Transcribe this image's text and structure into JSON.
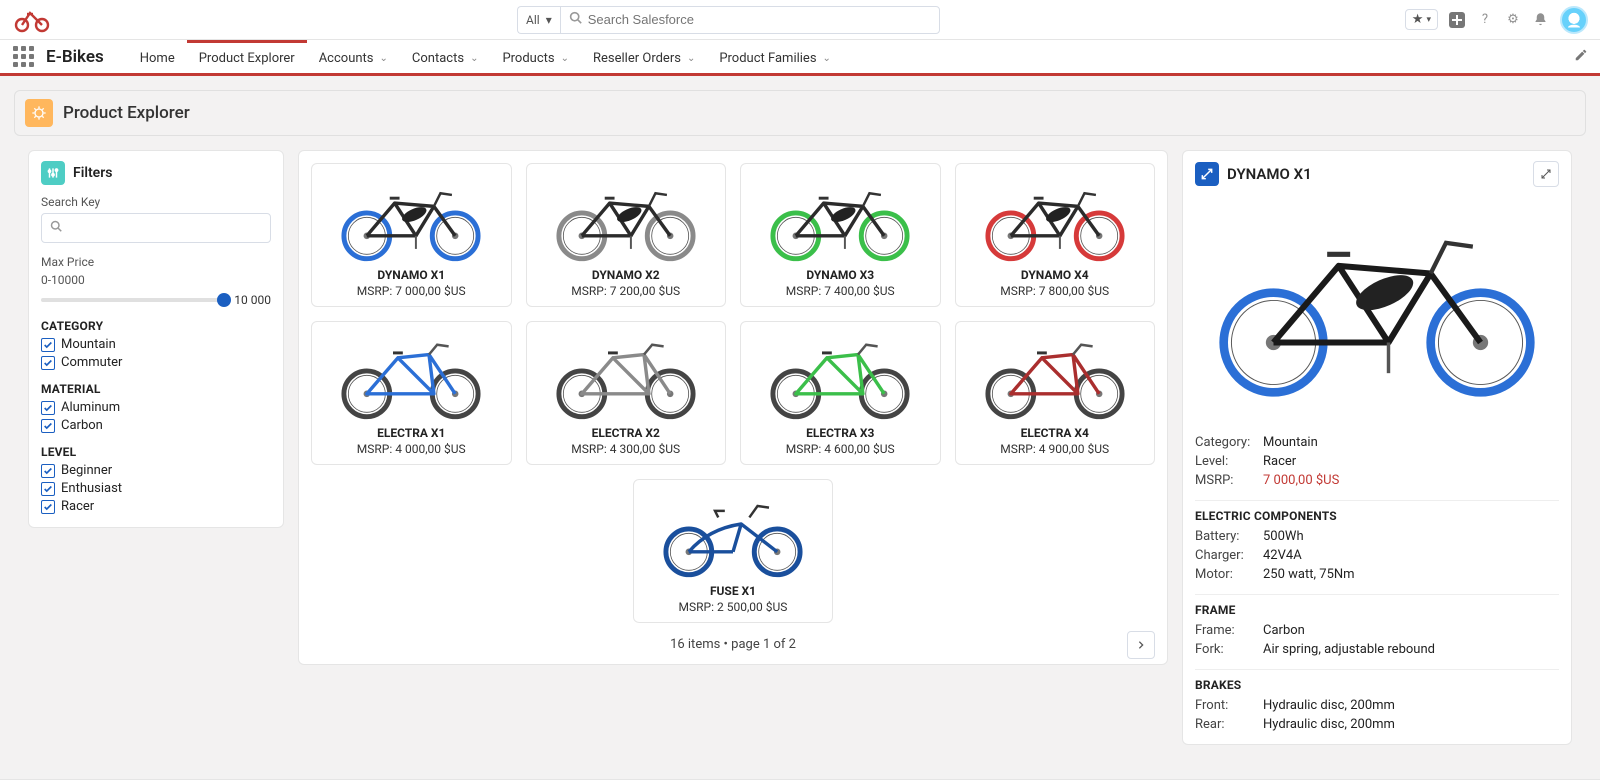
{
  "header": {
    "search_scope": "All",
    "search_placeholder": "Search Salesforce"
  },
  "nav": {
    "app_name": "E-Bikes",
    "items": [
      {
        "label": "Home",
        "dropdown": false,
        "active": false
      },
      {
        "label": "Product Explorer",
        "dropdown": false,
        "active": true
      },
      {
        "label": "Accounts",
        "dropdown": true,
        "active": false
      },
      {
        "label": "Contacts",
        "dropdown": true,
        "active": false
      },
      {
        "label": "Products",
        "dropdown": true,
        "active": false
      },
      {
        "label": "Reseller Orders",
        "dropdown": true,
        "active": false
      },
      {
        "label": "Product Families",
        "dropdown": true,
        "active": false
      }
    ]
  },
  "page_header": {
    "title": "Product Explorer"
  },
  "filters": {
    "title": "Filters",
    "search_key_label": "Search Key",
    "max_price_label": "Max Price",
    "max_price_range": "0-10000",
    "max_price_value": "10 000",
    "groups": [
      {
        "title": "CATEGORY",
        "options": [
          {
            "label": "Mountain",
            "checked": true
          },
          {
            "label": "Commuter",
            "checked": true
          }
        ]
      },
      {
        "title": "MATERIAL",
        "options": [
          {
            "label": "Aluminum",
            "checked": true
          },
          {
            "label": "Carbon",
            "checked": true
          }
        ]
      },
      {
        "title": "LEVEL",
        "options": [
          {
            "label": "Beginner",
            "checked": true
          },
          {
            "label": "Enthusiast",
            "checked": true
          },
          {
            "label": "Racer",
            "checked": true
          }
        ]
      }
    ]
  },
  "products": [
    {
      "name": "DYNAMO X1",
      "msrp": "MSRP: 7 000,00 $US",
      "style": "urban",
      "wheel": "#2b6fd6",
      "frame": "#2b2b2b"
    },
    {
      "name": "DYNAMO X2",
      "msrp": "MSRP: 7 200,00 $US",
      "style": "urban",
      "wheel": "#8a8a8a",
      "frame": "#2b2b2b"
    },
    {
      "name": "DYNAMO X3",
      "msrp": "MSRP: 7 400,00 $US",
      "style": "urban",
      "wheel": "#3bbf4a",
      "frame": "#2b2b2b"
    },
    {
      "name": "DYNAMO X4",
      "msrp": "MSRP: 7 800,00 $US",
      "style": "urban",
      "wheel": "#d63a3a",
      "frame": "#2b2b2b"
    },
    {
      "name": "ELECTRA X1",
      "msrp": "MSRP: 4 000,00 $US",
      "style": "mtb",
      "wheel": "#444",
      "frame": "#2b6fd6"
    },
    {
      "name": "ELECTRA X2",
      "msrp": "MSRP: 4 300,00 $US",
      "style": "mtb",
      "wheel": "#444",
      "frame": "#8a8a8a"
    },
    {
      "name": "ELECTRA X3",
      "msrp": "MSRP: 4 600,00 $US",
      "style": "mtb",
      "wheel": "#444",
      "frame": "#3bbf4a"
    },
    {
      "name": "ELECTRA X4",
      "msrp": "MSRP: 4 900,00 $US",
      "style": "mtb",
      "wheel": "#444",
      "frame": "#aa2e2e"
    },
    {
      "name": "FUSE X1",
      "msrp": "MSRP: 2 500,00 $US",
      "style": "step",
      "wheel": "#1a4f9c",
      "frame": "#1a4f9c"
    }
  ],
  "pager": {
    "summary": "16 items • page 1 of 2"
  },
  "detail": {
    "title": "DYNAMO X1",
    "top": [
      {
        "k": "Category:",
        "v": "Mountain"
      },
      {
        "k": "Level:",
        "v": "Racer"
      },
      {
        "k": "MSRP:",
        "v": "7 000,00 $US",
        "red": true
      }
    ],
    "sections": [
      {
        "title": "ELECTRIC COMPONENTS",
        "rows": [
          {
            "k": "Battery:",
            "v": "500Wh"
          },
          {
            "k": "Charger:",
            "v": "42V4A"
          },
          {
            "k": "Motor:",
            "v": "250 watt, 75Nm"
          }
        ]
      },
      {
        "title": "FRAME",
        "rows": [
          {
            "k": "Frame:",
            "v": "Carbon"
          },
          {
            "k": "Fork:",
            "v": "Air spring, adjustable rebound"
          }
        ]
      },
      {
        "title": "BRAKES",
        "rows": [
          {
            "k": "Front:",
            "v": "Hydraulic disc, 200mm"
          },
          {
            "k": "Rear:",
            "v": "Hydraulic disc, 200mm"
          }
        ]
      }
    ]
  }
}
